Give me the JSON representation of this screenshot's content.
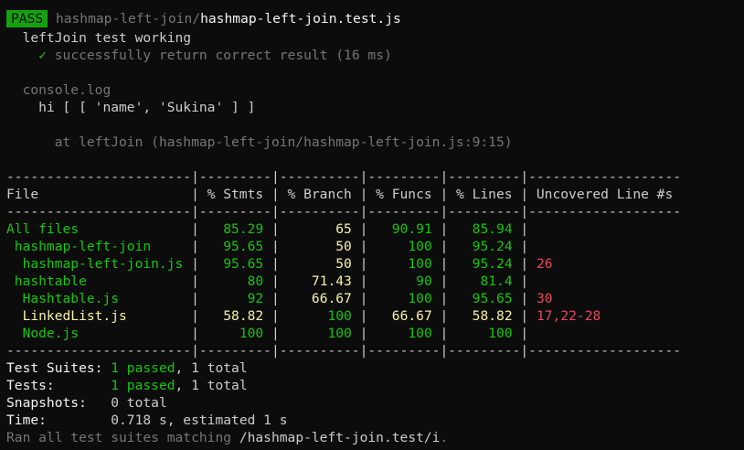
{
  "header": {
    "badge": "PASS",
    "path_dir": "hashmap-left-join/",
    "path_file": "hashmap-left-join.test.js"
  },
  "suite": {
    "describe": "leftJoin test working",
    "check": "✓",
    "test": "successfully return correct result (16 ms)"
  },
  "console": {
    "label": "console.log",
    "output": "hi [ [ 'name', 'Sukina' ] ]",
    "location": "at leftJoin (hashmap-left-join/hashmap-left-join.js:9:15)"
  },
  "coverage": {
    "separator": "-----------------------|---------|----------|---------|---------|-------------------",
    "header": "File                   | % Stmts | % Branch | % Funcs | % Lines | Uncovered Line #s ",
    "rows": [
      {
        "file": "All files",
        "indent": "",
        "stmts": "85.29",
        "branch": "65",
        "funcs": "90.91",
        "lines": "85.94",
        "uncovered": ""
      },
      {
        "file": "hashmap-left-join",
        "indent": " ",
        "stmts": "95.65",
        "branch": "50",
        "funcs": "100",
        "lines": "95.24",
        "uncovered": ""
      },
      {
        "file": "hashmap-left-join.js",
        "indent": "  ",
        "stmts": "95.65",
        "branch": "50",
        "funcs": "100",
        "lines": "95.24",
        "uncovered": "26"
      },
      {
        "file": "hashtable",
        "indent": " ",
        "stmts": "80",
        "branch": "71.43",
        "funcs": "90",
        "lines": "81.4",
        "uncovered": ""
      },
      {
        "file": "Hashtable.js",
        "indent": "  ",
        "stmts": "92",
        "branch": "66.67",
        "funcs": "100",
        "lines": "95.65",
        "uncovered": "30"
      },
      {
        "file": "LinkedList.js",
        "indent": "  ",
        "stmts": "58.82",
        "branch": "100",
        "funcs": "66.67",
        "lines": "58.82",
        "uncovered": "17,22-28"
      },
      {
        "file": "Node.js",
        "indent": "  ",
        "stmts": "100",
        "branch": "100",
        "funcs": "100",
        "lines": "100",
        "uncovered": ""
      }
    ]
  },
  "summary": {
    "suites_label": "Test Suites:",
    "suites_passed": "1 passed",
    "suites_total": ", 1 total",
    "tests_label": "Tests:",
    "tests_passed": "1 passed",
    "tests_total": ", 1 total",
    "snapshots_label": "Snapshots:",
    "snapshots_value": "0 total",
    "time_label": "Time:",
    "time_value": "0.718 s, estimated 1 s",
    "ran_prefix": "Ran all test suites matching ",
    "ran_pattern": "/hashmap-left-join.test/i",
    "ran_suffix": "."
  },
  "colors": {
    "background": "#0c0c0c",
    "pass_badge": "#13a10e",
    "green": "#16c60c",
    "yellow": "#f9f1a5",
    "red": "#e74856",
    "dim": "#767676"
  }
}
